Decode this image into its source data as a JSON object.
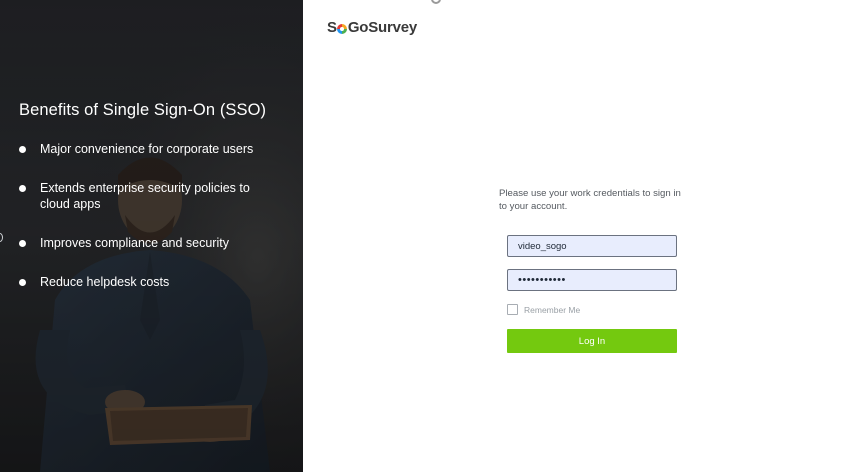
{
  "benefits": {
    "title": "Benefits of Single Sign-On (SSO)",
    "items": [
      {
        "label": "Major convenience for corporate users"
      },
      {
        "label": "Extends enterprise security policies to cloud apps"
      },
      {
        "label": "Improves compliance and security"
      },
      {
        "label": "Reduce helpdesk costs"
      }
    ]
  },
  "logo": {
    "prefix": "S",
    "suffix": "GoSurvey",
    "mark_icon": "sogo-logo-mark",
    "mark_colors": [
      "#f5a623",
      "#4caf50",
      "#2196f3",
      "#e53935"
    ]
  },
  "login": {
    "instructions": "Please use your work credentials to sign in to your account.",
    "username_value": "video_sogo",
    "password_masked": "•••••••••••",
    "remember_label": "Remember Me",
    "remember_checked": false,
    "submit_label": "Log In"
  },
  "colors": {
    "accent_green": "#74c90f",
    "input_bg": "#e8edfd",
    "left_panel": "#2b2d30"
  }
}
